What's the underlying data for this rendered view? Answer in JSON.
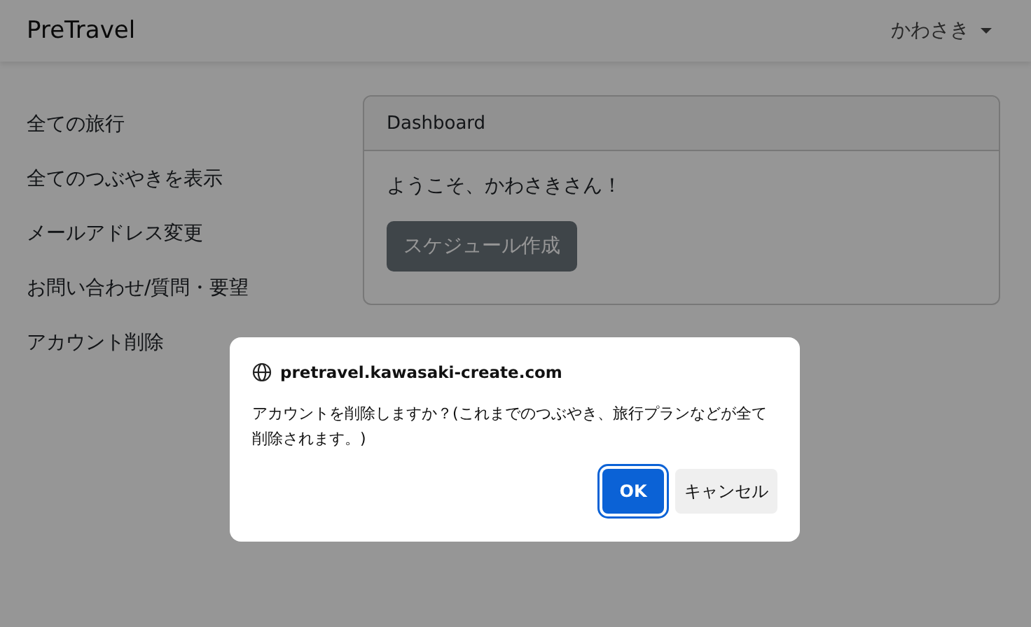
{
  "navbar": {
    "brand": "PreTravel",
    "user_menu": "かわさき"
  },
  "sidebar": {
    "items": [
      "全ての旅行",
      "全てのつぶやきを表示",
      "メールアドレス変更",
      "お問い合わせ/質問・要望",
      "アカウント削除"
    ]
  },
  "card": {
    "title": "Dashboard",
    "welcome": "ようこそ、かわさきさん！",
    "button": "スケジュール作成"
  },
  "dialog": {
    "origin": "pretravel.kawasaki-create.com",
    "message": "アカウントを削除しますか？(これまでのつぶやき、旅行プランなどが全て削除されます。)",
    "buttons": [
      {
        "label": "OK",
        "kind": "primary"
      },
      {
        "label": "キャンセル",
        "kind": "secondary"
      }
    ]
  }
}
